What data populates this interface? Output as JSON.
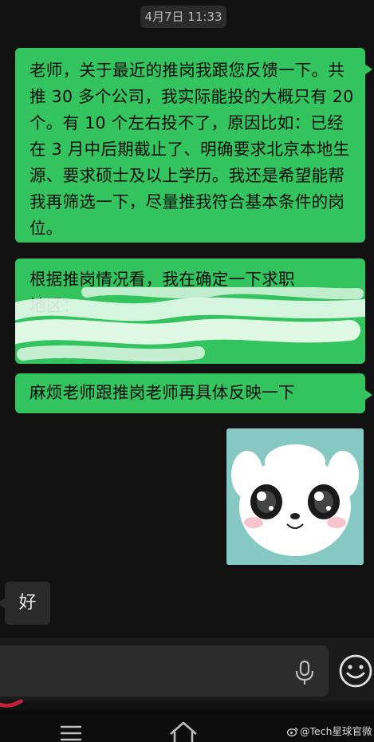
{
  "chat": {
    "timestamp": "4月7日 11:33",
    "messages": [
      {
        "sender": "self",
        "text": "老师，关于最近的推岗我跟您反馈一下。共推 30 多个公司，我实际能投的大概只有 20 个。有 10 个左右投不了，原因比如：已经在 3 月中后期截止了、明确要求北京本地生源、要求硕士及以上学历。我还是希望能帮我再筛选一下，尽量推我符合基本条件的岗位。"
      },
      {
        "sender": "self",
        "line1": "根据推岗情况看，我在确定一下求职",
        "line2": "地区："
      },
      {
        "sender": "self",
        "text": "麻烦老师跟推岗老师再具体反映一下"
      },
      {
        "sender": "self",
        "type": "sticker",
        "sticker": "white-puppy-teary-eyes"
      },
      {
        "sender": "other",
        "text": "好"
      }
    ]
  },
  "input_bar": {
    "mic_icon": "microphone-icon",
    "emoji_icon": "emoji-icon"
  },
  "nav": {
    "menu_icon": "menu-icon",
    "home_icon": "home-icon"
  },
  "watermark": {
    "text": "@Tech星球官微"
  },
  "colors": {
    "background": "#111111",
    "self_bubble": "#33c35f",
    "other_bubble": "#2a2a2a",
    "sticker_bg": "#86c9c3"
  }
}
